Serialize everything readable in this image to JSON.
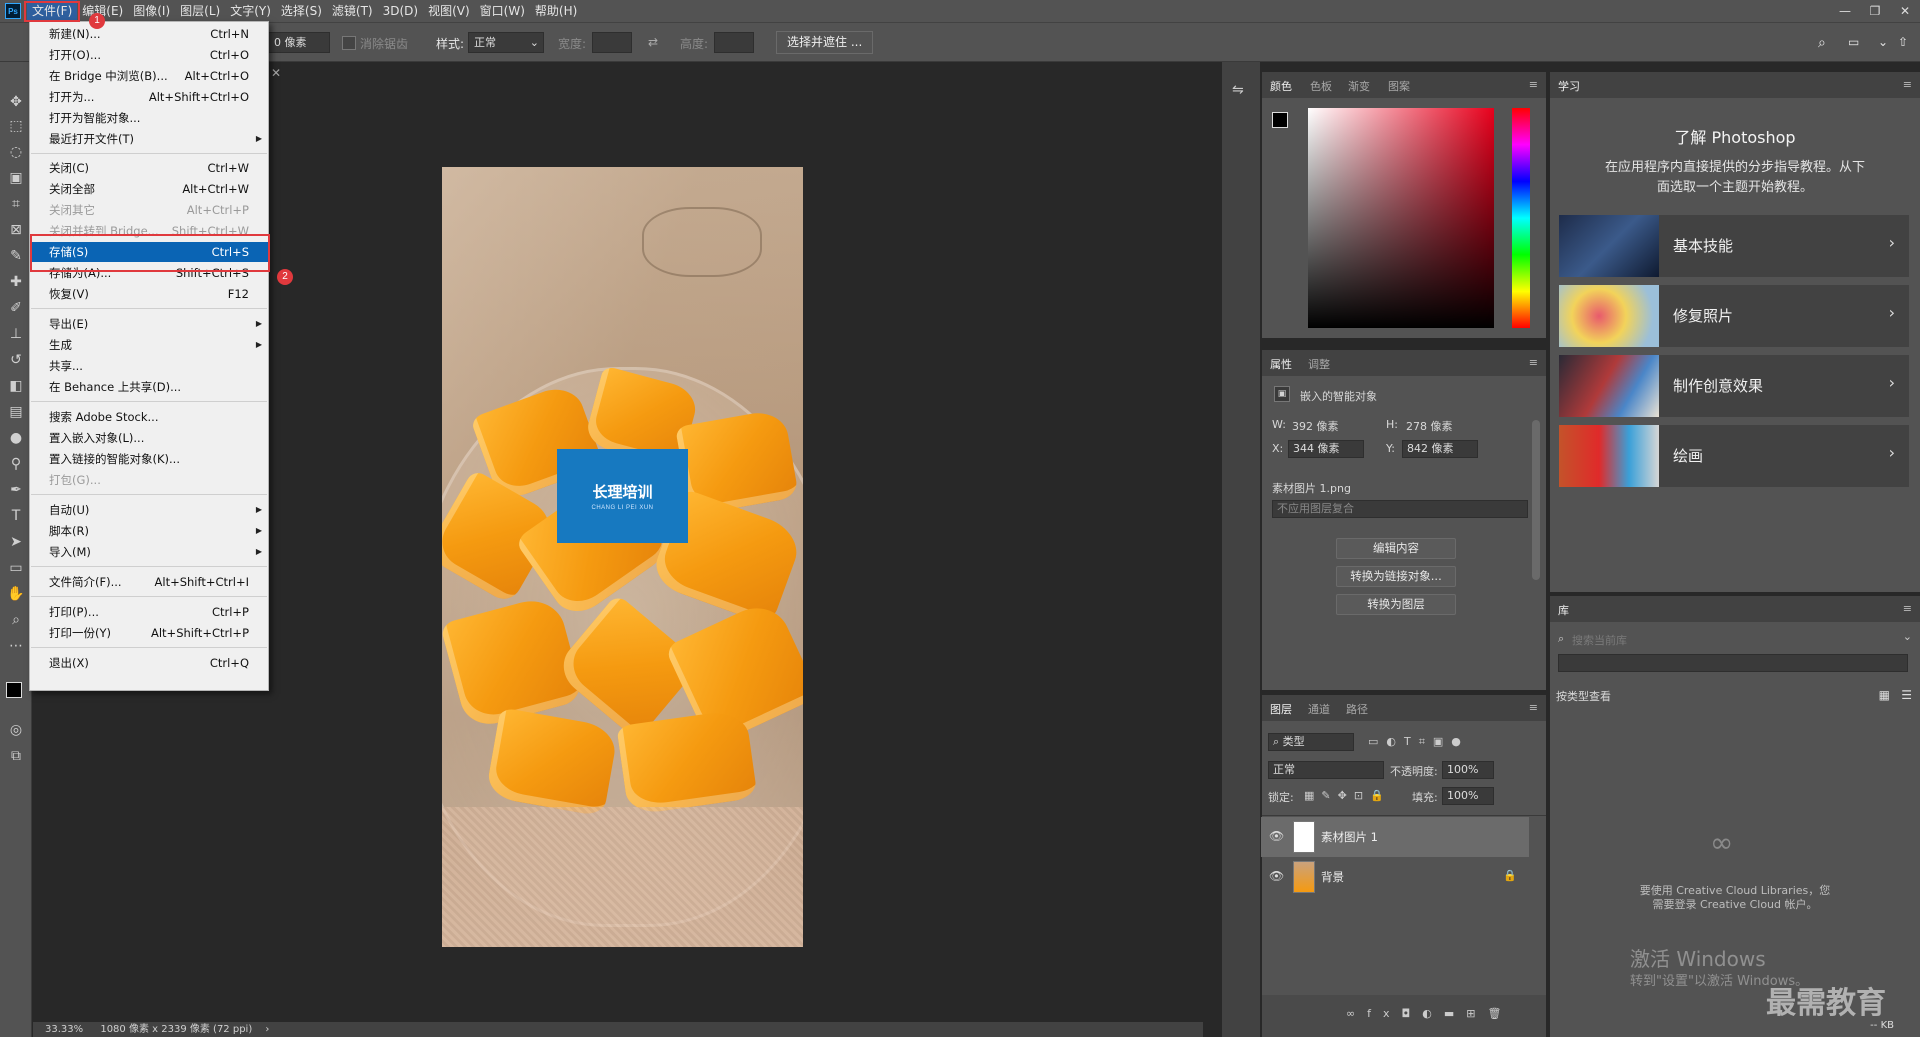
{
  "menubar": {
    "logo": "Ps",
    "items": [
      "文件(F)",
      "编辑(E)",
      "图像(I)",
      "图层(L)",
      "文字(Y)",
      "选择(S)",
      "滤镜(T)",
      "3D(D)",
      "视图(V)",
      "窗口(W)",
      "帮助(H)"
    ],
    "window_controls": [
      "—",
      "❐",
      "✕"
    ]
  },
  "options": {
    "feather_value": "0 像素",
    "antialias_label": "消除锯齿",
    "style_label": "样式:",
    "style_value": "正常",
    "width_label": "宽度:",
    "height_label": "高度:",
    "select_mask_button": "选择并遮住 ..."
  },
  "file_menu": {
    "items": [
      {
        "label": "新建(N)...",
        "shortcut": "Ctrl+N"
      },
      {
        "label": "打开(O)...",
        "shortcut": "Ctrl+O"
      },
      {
        "label": "在 Bridge 中浏览(B)...",
        "shortcut": "Alt+Ctrl+O"
      },
      {
        "label": "打开为...",
        "shortcut": "Alt+Shift+Ctrl+O"
      },
      {
        "label": "打开为智能对象...",
        "shortcut": ""
      },
      {
        "label": "最近打开文件(T)",
        "shortcut": ""
      },
      {
        "label": "关闭(C)",
        "shortcut": "Ctrl+W"
      },
      {
        "label": "关闭全部",
        "shortcut": "Alt+Ctrl+W"
      },
      {
        "label": "关闭其它",
        "shortcut": "Alt+Ctrl+P"
      },
      {
        "label": "关闭并转到 Bridge...",
        "shortcut": "Shift+Ctrl+W"
      },
      {
        "label": "存储(S)",
        "shortcut": "Ctrl+S"
      },
      {
        "label": "存储为(A)...",
        "shortcut": "Shift+Ctrl+S"
      },
      {
        "label": "恢复(V)",
        "shortcut": "F12"
      },
      {
        "label": "导出(E)",
        "shortcut": ""
      },
      {
        "label": "生成",
        "shortcut": ""
      },
      {
        "label": "共享...",
        "shortcut": ""
      },
      {
        "label": "在 Behance 上共享(D)...",
        "shortcut": ""
      },
      {
        "label": "搜索 Adobe Stock...",
        "shortcut": ""
      },
      {
        "label": "置入嵌入对象(L)...",
        "shortcut": ""
      },
      {
        "label": "置入链接的智能对象(K)...",
        "shortcut": ""
      },
      {
        "label": "打包(G)...",
        "shortcut": ""
      },
      {
        "label": "自动(U)",
        "shortcut": ""
      },
      {
        "label": "脚本(R)",
        "shortcut": ""
      },
      {
        "label": "导入(M)",
        "shortcut": ""
      },
      {
        "label": "文件简介(F)...",
        "shortcut": "Alt+Shift+Ctrl+I"
      },
      {
        "label": "打印(P)...",
        "shortcut": "Ctrl+P"
      },
      {
        "label": "打印一份(Y)",
        "shortcut": "Alt+Shift+Ctrl+P"
      },
      {
        "label": "退出(X)",
        "shortcut": "Ctrl+Q"
      }
    ],
    "badge_1": "1",
    "badge_2": "2"
  },
  "document": {
    "logo_title": "长理培训",
    "logo_subtitle": "CHANG LI PEI XUN"
  },
  "status": {
    "zoom": "33.33%",
    "doc_info": "1080 像素 x 2339 像素 (72 ppi)"
  },
  "color_panel": {
    "tabs": [
      "颜色",
      "色板",
      "渐变",
      "图案"
    ]
  },
  "properties_panel": {
    "tabs": [
      "属性",
      "调整"
    ],
    "type": "嵌入的智能对象",
    "w_label": "W:",
    "w_value": "392 像素",
    "h_label": "H:",
    "h_value": "278 像素",
    "x_label": "X:",
    "x_value": "344 像素",
    "y_label": "Y:",
    "y_value": "842 像素",
    "filename": "素材图片 1.png",
    "comp_placeholder": "不应用图层复合",
    "buttons": [
      "编辑内容",
      "转换为链接对象...",
      "转换为图层"
    ]
  },
  "layers_panel": {
    "tabs": [
      "图层",
      "通道",
      "路径"
    ],
    "filter_kind": "类型",
    "blend_mode": "正常",
    "opacity_label": "不透明度:",
    "opacity_value": "100%",
    "lock_label": "锁定:",
    "fill_label": "填充:",
    "fill_value": "100%",
    "layers": [
      {
        "name": "素材图片 1"
      },
      {
        "name": "背景"
      }
    ]
  },
  "learn_panel": {
    "tab": "学习",
    "title": "了解 Photoshop",
    "desc_line1": "在应用程序内直接提供的分步指导教程。从下",
    "desc_line2": "面选取一个主题开始教程。",
    "cards": [
      "基本技能",
      "修复照片",
      "制作创意效果",
      "绘画"
    ]
  },
  "library_panel": {
    "tab": "库",
    "search_placeholder": "搜索当前库",
    "view_by": "按类型查看",
    "msg_line1": "要使用 Creative Cloud Libraries，您",
    "msg_line2": "需要登录 Creative Cloud 帐户。",
    "size": "-- KB"
  },
  "watermark": {
    "activate": "激活 Windows",
    "activate_sub": "转到\"设置\"以激活 Windows。",
    "brand": "最需教育"
  },
  "colors": {
    "accent_blue": "#0a64b4",
    "annotation_red": "#e0393d",
    "logo_blue": "#1779c0"
  }
}
